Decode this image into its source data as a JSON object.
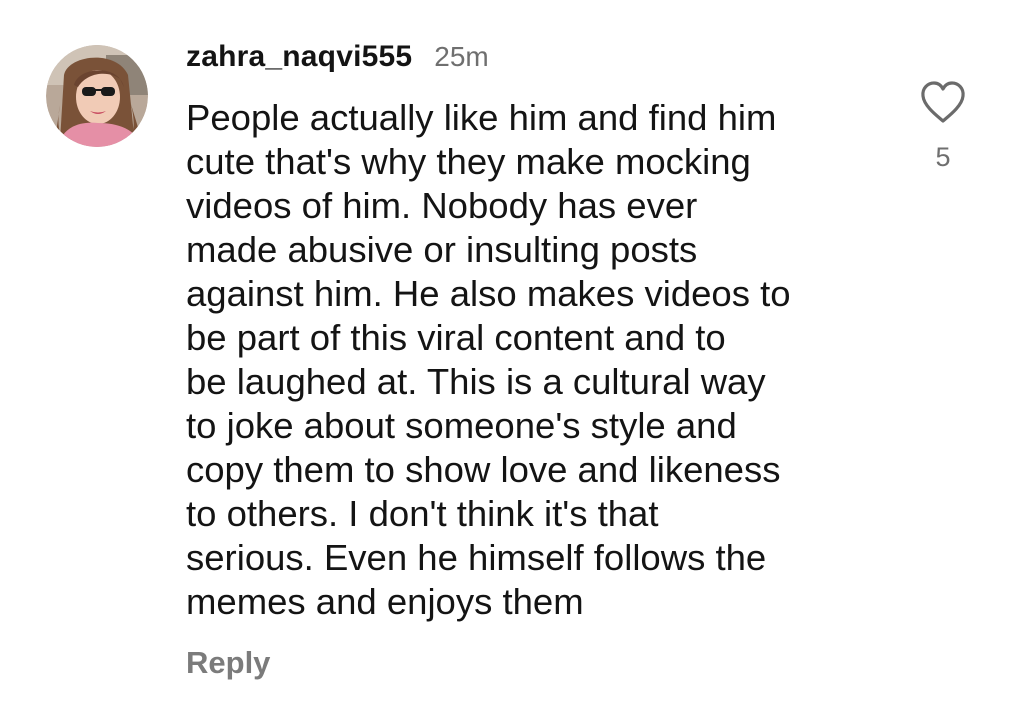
{
  "comment": {
    "username": "zahra_naqvi555",
    "timestamp": "25m",
    "text": "People actually like him and find him\ncute that's why they make mocking\nvideos of him. Nobody has ever\nmade abusive or insulting posts\nagainst him. He also makes videos to\nbe part of this viral content and to\nbe laughed at. This is a cultural way\nto joke about someone's style and\ncopy them to show love and likeness\nto others. I don't think it's that\nserious. Even he himself follows the\nmemes and enjoys them",
    "like_count": "5",
    "reply_label": "Reply",
    "like_icon": "heart-outline-icon",
    "avatar_image": "profile-photo"
  },
  "colors": {
    "text_primary": "#141414",
    "text_secondary": "#6f6f6f",
    "reply": "#7b7b7b",
    "background": "#ffffff"
  }
}
